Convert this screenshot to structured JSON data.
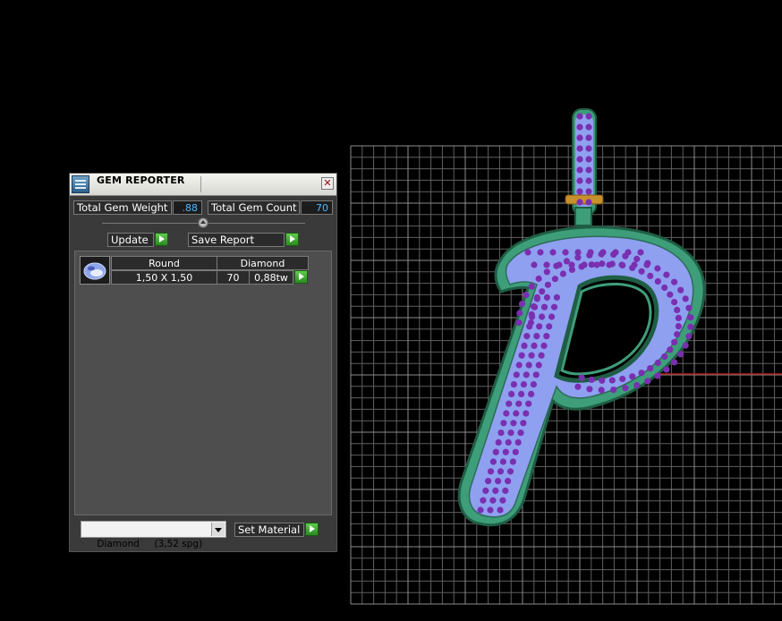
{
  "panel": {
    "title": "GEM REPORTER",
    "close_glyph": "✕",
    "total_gem_weight_label": "Total Gem Weight",
    "total_gem_weight_value": ".88",
    "total_gem_count_label": "Total Gem Count",
    "total_gem_count_value": "70",
    "update_label": "Update",
    "save_report_label": "Save Report",
    "gem_list": [
      {
        "shape": "Round",
        "material": "Diamond",
        "size": "1,50 X 1,50",
        "count": "70",
        "weight": "0,88tw"
      }
    ],
    "material_select_value": "Diamond     (3,52 spg)",
    "set_material_label": "Set Material"
  },
  "icons": {
    "app": "gem-reporter-app-icon",
    "close": "close-icon",
    "play": "play-arrow-icon",
    "gem": "round-gem-icon",
    "dropdown": "chevron-down-icon"
  },
  "colors": {
    "viewport_bg": "#000000",
    "grid": "#6e6e6e",
    "metal": "#3e9e7a",
    "pave": "#8fa0f0",
    "gems": "#7a2fb0",
    "value_text": "#4fb7ff",
    "button_green": "#3fae32"
  }
}
